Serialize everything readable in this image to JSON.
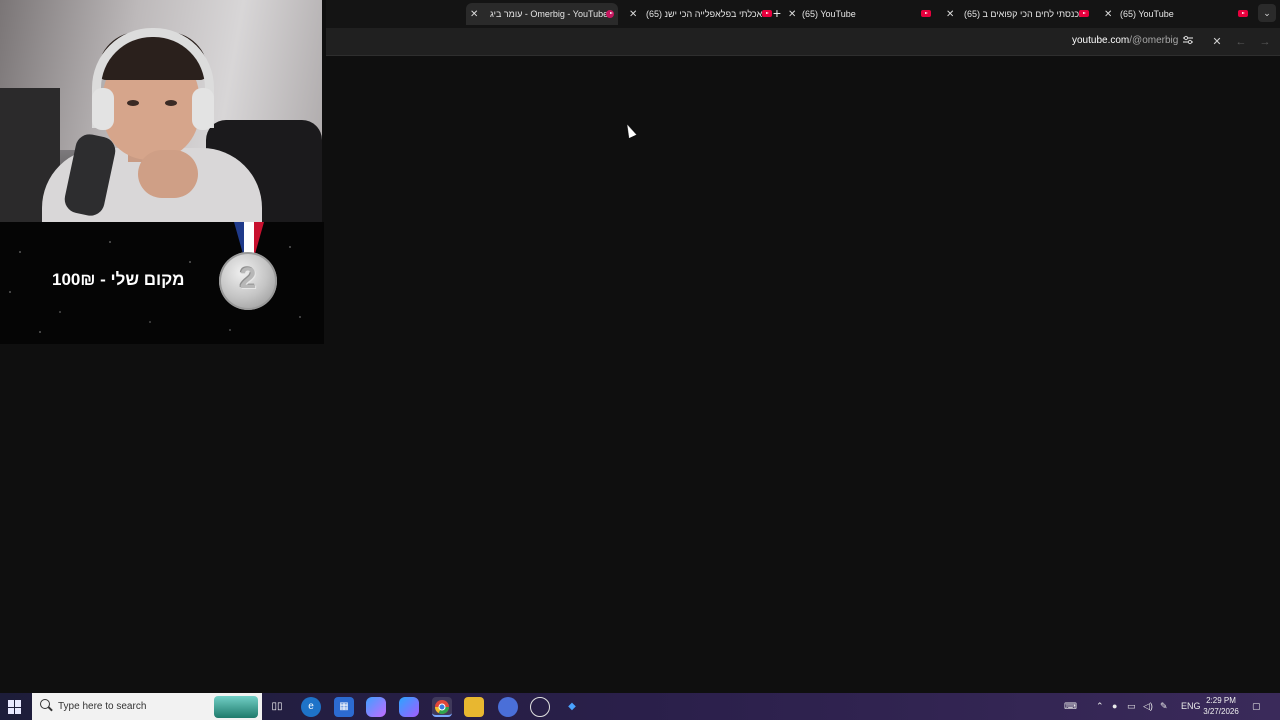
{
  "browser": {
    "new_tab_label": "+",
    "tabs": [
      {
        "title": "עומר ביג - Omerbig - YouTube",
        "active": true,
        "favicon": "swirl-icon"
      },
      {
        "title": "(65) אכלתי בפלאפלייה הכי ישנ",
        "active": false,
        "favicon": "youtube-icon"
      },
      {
        "title": "(65) YouTube",
        "active": false,
        "favicon": "youtube-icon"
      },
      {
        "title": "(65) נכנסתי לחים הכי קפואים ב",
        "active": false,
        "favicon": "youtube-icon"
      },
      {
        "title": "(65) YouTube",
        "active": false,
        "favicon": "youtube-icon"
      }
    ],
    "close_glyph": "✕",
    "tab_menu_glyph": "⌄"
  },
  "toolbar": {
    "url_domain": "youtube.com",
    "url_path": "/@omerbig",
    "icons": [
      "site-settings-icon",
      "close-icon",
      "back-icon",
      "forward-icon"
    ]
  },
  "overlay": {
    "prize_text": "מקום שלי - 100₪",
    "medal_number": "2"
  },
  "taskbar": {
    "search_placeholder": "Type here to search",
    "apps": [
      "task-view-icon",
      "edge-icon",
      "store-icon",
      "copilot-icon",
      "m365-icon",
      "chrome-icon",
      "files-icon",
      "chrome-profile-icon",
      "obs-icon",
      "app-icon"
    ],
    "tray_lang": "ENG",
    "time": "2:29 PM",
    "date": "3/27/2026"
  },
  "colors": {
    "page_bg": "#0f0f0f",
    "youtube_red": "#e8003d",
    "taskbar": "#2a1f4a"
  }
}
